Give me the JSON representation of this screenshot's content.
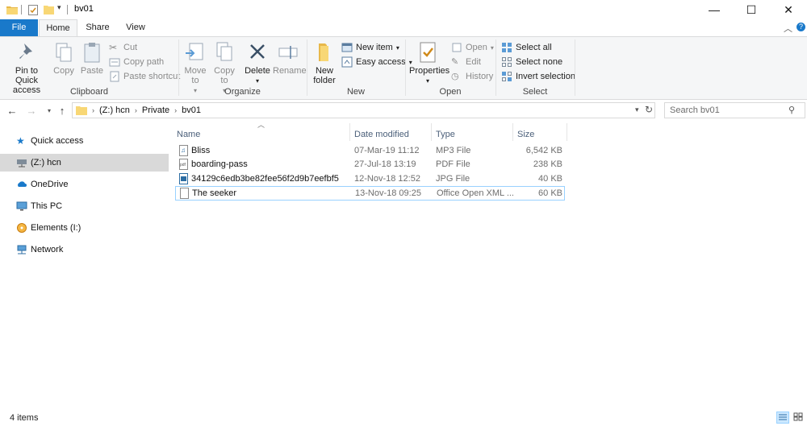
{
  "window": {
    "title": "bv01",
    "minimize_glyph": "—",
    "maximize_glyph": "☐",
    "close_glyph": "✕"
  },
  "qat": {
    "icons": [
      "folder-icon",
      "properties-icon",
      "new-folder-icon",
      "customize-arrow-icon"
    ]
  },
  "tabs": [
    {
      "label": "File"
    },
    {
      "label": "Home"
    },
    {
      "label": "Share"
    },
    {
      "label": "View"
    }
  ],
  "ribbon": {
    "clipboard": {
      "group_label": "Clipboard",
      "pin_label": "Pin to Quick access",
      "copy_label": "Copy",
      "paste_label": "Paste",
      "cut_label": "Cut",
      "copy_path_label": "Copy path",
      "paste_shortcut_label": "Paste shortcut"
    },
    "organize": {
      "group_label": "Organize",
      "move_to_label": "Move to",
      "copy_to_label": "Copy to",
      "delete_label": "Delete",
      "rename_label": "Rename"
    },
    "new": {
      "group_label": "New",
      "new_folder_label": "New folder",
      "new_item_label": "New item",
      "easy_access_label": "Easy access"
    },
    "open": {
      "group_label": "Open",
      "properties_label": "Properties",
      "open_label": "Open",
      "edit_label": "Edit",
      "history_label": "History"
    },
    "select": {
      "group_label": "Select",
      "select_all_label": "Select all",
      "select_none_label": "Select none",
      "invert_label": "Invert selection"
    }
  },
  "address": {
    "crumbs": [
      "(Z:) hcn",
      "Private",
      "bv01"
    ],
    "search_placeholder": "Search bv01"
  },
  "nav": {
    "items": [
      {
        "label": "Quick access",
        "icon": "star-icon"
      },
      {
        "label": "(Z:) hcn",
        "icon": "network-drive-icon"
      },
      {
        "label": "OneDrive",
        "icon": "cloud-icon"
      },
      {
        "label": "This PC",
        "icon": "monitor-icon"
      },
      {
        "label": "Elements (I:)",
        "icon": "drive-icon"
      },
      {
        "label": "Network",
        "icon": "network-icon"
      }
    ]
  },
  "table": {
    "headers": {
      "name": "Name",
      "date": "Date modified",
      "type": "Type",
      "size": "Size"
    },
    "rows": [
      {
        "name": "Bliss",
        "date": "07-Mar-19 11:12",
        "type": "MP3 File",
        "size": "6,542 KB",
        "icon": "audio-file-icon"
      },
      {
        "name": "boarding-pass",
        "date": "27-Jul-18 13:19",
        "type": "PDF File",
        "size": "238 KB",
        "icon": "pdf-file-icon"
      },
      {
        "name": "34129c6edb3be82fee56f2d9b7eefbf5",
        "date": "12-Nov-18 12:52",
        "type": "JPG File",
        "size": "40 KB",
        "icon": "image-file-icon"
      },
      {
        "name": "The seeker",
        "date": "13-Nov-18 09:25",
        "type": "Office Open XML ...",
        "size": "60 KB",
        "icon": "document-file-icon"
      }
    ]
  },
  "status": {
    "count": "4 items"
  },
  "colors": {
    "accent": "#1979ca",
    "ribbon_bg": "#f5f6f7",
    "selected_nav": "#d9d9d9",
    "focus_border": "#99d1ff"
  }
}
